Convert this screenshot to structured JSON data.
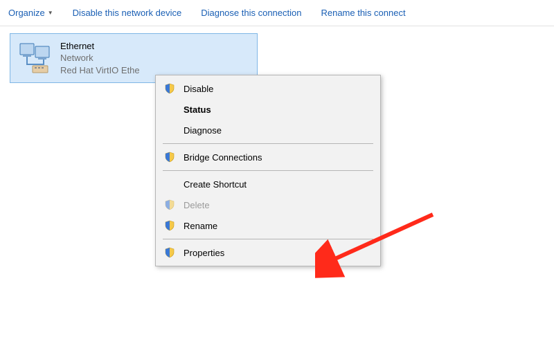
{
  "toolbar": {
    "organize": "Organize",
    "disable_device": "Disable this network device",
    "diagnose": "Diagnose this connection",
    "rename": "Rename this connect"
  },
  "adapter": {
    "name": "Ethernet",
    "network": "Network",
    "description": "Red Hat VirtIO Ethe"
  },
  "context_menu": {
    "disable": "Disable",
    "status": "Status",
    "diagnose": "Diagnose",
    "bridge": "Bridge Connections",
    "shortcut": "Create Shortcut",
    "delete": "Delete",
    "rename": "Rename",
    "properties": "Properties"
  },
  "colors": {
    "selection_bg": "#d7e9fa",
    "selection_border": "#7fb6e6",
    "link": "#1a5fb4",
    "arrow": "#ff2a1a"
  }
}
